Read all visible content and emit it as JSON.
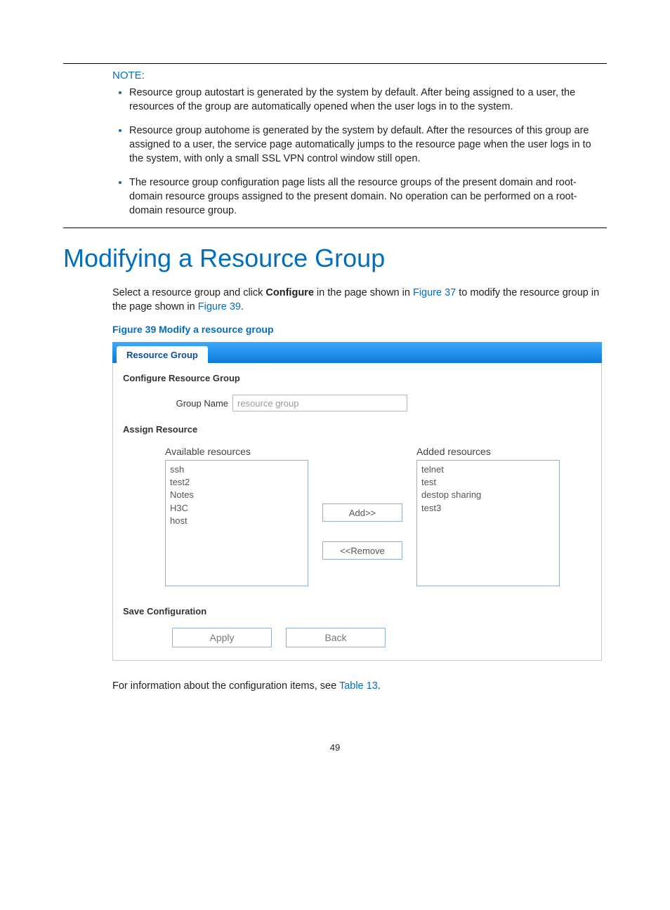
{
  "note": {
    "label": "NOTE:",
    "items": [
      "Resource group autostart is generated by the system by default. After being assigned to a user, the resources of the group are automatically opened when the user logs in to the system.",
      "Resource group autohome is generated by the system by default. After the resources of this group are assigned to a user, the service page automatically jumps to the resource page when the user logs in to the system, with only a small SSL VPN control window still open.",
      "The resource group configuration page lists all the resource groups of the present domain and root-domain resource groups assigned to the present domain. No operation can be performed on a root-domain resource group."
    ]
  },
  "heading": "Modifying a Resource Group",
  "intro": {
    "t1": "Select a resource group and click ",
    "bold": "Configure",
    "t2": " in the page shown in ",
    "link1": "Figure 37",
    "t3": " to modify the resource group in the page shown in ",
    "link2": "Figure 39",
    "t4": "."
  },
  "figCaption": "Figure 39 Modify a resource group",
  "figure": {
    "tab": "Resource Group",
    "sec1": "Configure Resource Group",
    "groupNameLabel": "Group Name",
    "groupNameValue": "resource group",
    "sec2": "Assign Resource",
    "availableTitle": "Available resources",
    "available": [
      "ssh",
      "test2",
      "Notes",
      "H3C",
      "host"
    ],
    "addBtn": "Add>>",
    "removeBtn": "<<Remove",
    "addedTitle": "Added resources",
    "added": [
      "telnet",
      "test",
      "destop sharing",
      "test3"
    ],
    "sec3": "Save Configuration",
    "applyBtn": "Apply",
    "backBtn": "Back"
  },
  "outro": {
    "t1": "For information about the configuration items, see ",
    "link": "Table 13",
    "t2": "."
  },
  "pageNumber": "49"
}
